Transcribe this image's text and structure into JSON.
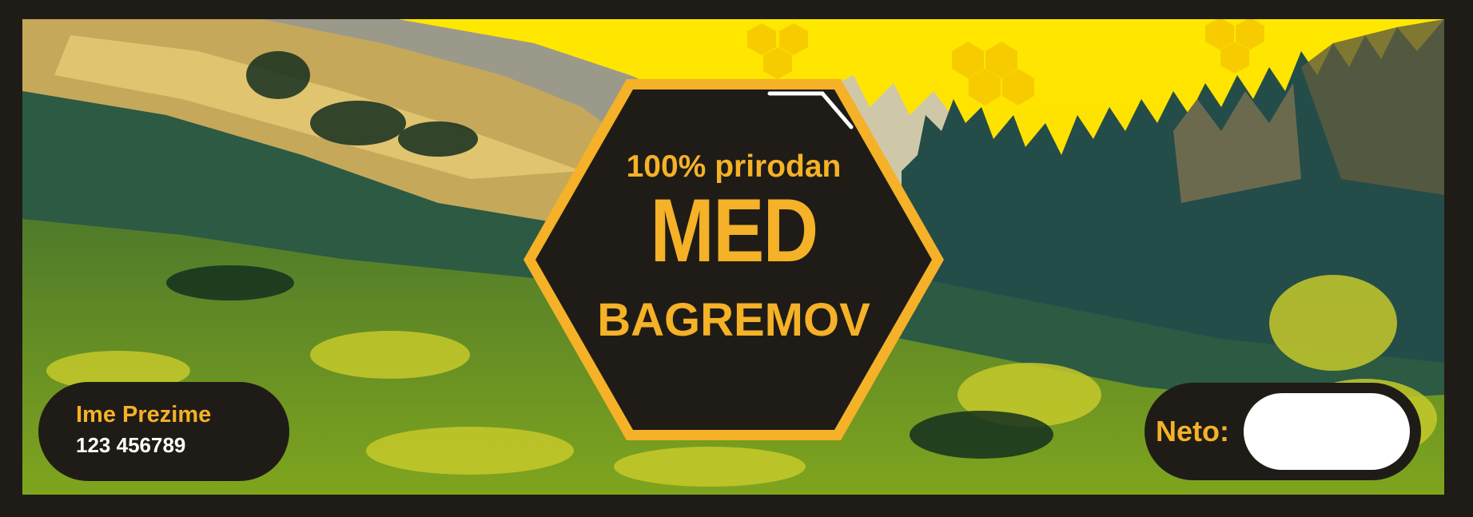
{
  "hexagon": {
    "tagline": "100% prirodan",
    "product": "MED",
    "variety": "BAGREMOV"
  },
  "producer": {
    "name": "Ime Prezime",
    "phone": "123 456789"
  },
  "weight": {
    "label": "Neto:",
    "value": ""
  },
  "colors": {
    "background": "#1f1c17",
    "accent": "#f5b127",
    "sky": "#ffe300",
    "forest": "#244c49",
    "meadow": "#5f8a23"
  },
  "icons": {
    "honeycomb": "honeycomb-icon",
    "hexagon": "hexagon-badge"
  }
}
